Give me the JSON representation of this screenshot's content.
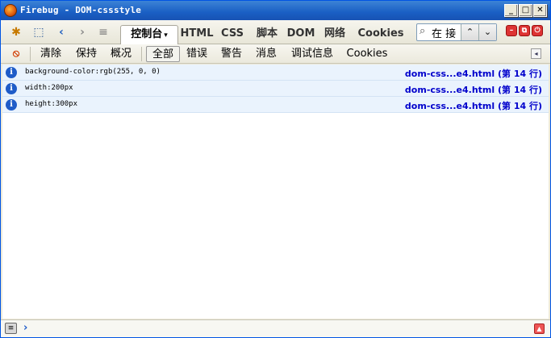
{
  "window": {
    "title": "Firebug - DOM-cssstyle",
    "min": "_",
    "max": "□",
    "close": "✕"
  },
  "toolbar": {
    "icons": {
      "bug": "firebug-icon",
      "inspect": "inspect-icon",
      "back": "‹",
      "forward": "›",
      "list": "≡"
    },
    "tabs": [
      {
        "label": "控制台",
        "caret": "▾",
        "active": true
      },
      {
        "label": "HTML"
      },
      {
        "label": "CSS"
      },
      {
        "label": "脚本"
      },
      {
        "label": "DOM"
      },
      {
        "label": "网络"
      },
      {
        "label": "Cookies"
      }
    ],
    "search": {
      "value": "在 接",
      "up": "⌃",
      "down": "⌄"
    },
    "fb_buttons": [
      "–",
      "⧉",
      "⏻"
    ]
  },
  "console_toolbar": {
    "clear": "清除",
    "persist": "保持",
    "profile": "概况",
    "filters": [
      "全部",
      "错误",
      "警告",
      "消息",
      "调试信息",
      "Cookies"
    ],
    "active_filter": "全部"
  },
  "log": [
    {
      "message": "background-color:rgb(255, 0, 0)",
      "source": "dom-css...e4.html (第 14 行)"
    },
    {
      "message": "width:200px",
      "source": "dom-css...e4.html (第 14 行)"
    },
    {
      "message": "height:300px",
      "source": "dom-css...e4.html (第 14 行)"
    }
  ],
  "commandline": {
    "prompt": "›",
    "value": ""
  }
}
